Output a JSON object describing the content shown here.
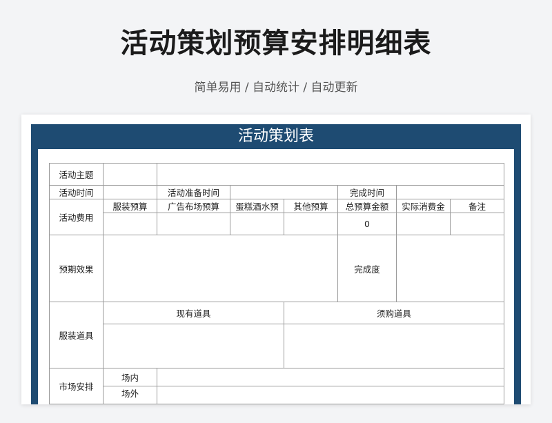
{
  "header": {
    "title": "活动策划预算安排明细表",
    "subtitle": "简单易用 / 自动统计 / 自动更新"
  },
  "sheet": {
    "title": "活动策划表",
    "labels": {
      "theme": "活动主题",
      "time": "活动时间",
      "prep_time": "活动准备时间",
      "finish_time": "完成时间",
      "cost": "活动费用",
      "expected": "预期效果",
      "completion": "完成度",
      "props": "服装道具",
      "existing_props": "现有道具",
      "needed_props": "须购道具",
      "venue": "市场安排",
      "indoor": "场内",
      "outdoor": "场外"
    },
    "budget_headers": [
      "服装预算",
      "广告布场预算",
      "蛋糕酒水预",
      "其他预算",
      "总预算金额",
      "实际消费金",
      "备注"
    ],
    "total_budget": "0"
  }
}
